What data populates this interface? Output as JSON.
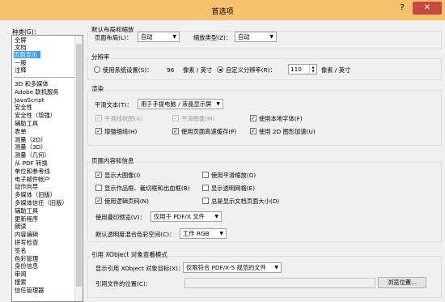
{
  "window": {
    "title": "首选项",
    "help": "?",
    "close": "✕"
  },
  "categories": {
    "label": "种类(G)：",
    "top": [
      "全屏",
      "文档",
      "页面显示"
    ],
    "top2": [
      "一般",
      "注释"
    ],
    "items": [
      "3D 和多媒体",
      "Adobe 联机服务",
      "JavaScript",
      "安全性",
      "安全性（增强）",
      "辅助工具",
      "表单",
      "测量（2D）",
      "测量（3D）",
      "测量（几何）",
      "从 PDF 转换",
      "单位和参考线",
      "电子邮件帐户",
      "动作向导",
      "多媒体（旧版）",
      "多媒体信任（旧版）",
      "辅助工具",
      "更新程序",
      "朗读",
      "内容编辑",
      "拼写检查",
      "签名",
      "色彩管理",
      "身份信息",
      "审阅",
      "搜索",
      "信任管理器"
    ],
    "selected": "页面显示"
  },
  "layout": {
    "title": "默认布局和缩放",
    "page_layout_label": "页面布局(L)：",
    "page_layout_value": "自动",
    "zoom_label": "缩放类型(Z)：",
    "zoom_value": "自动"
  },
  "resolution": {
    "title": "分辨率",
    "system_label": "使用系统设置(S)：",
    "system_value": "96",
    "system_unit": "像素 / 英寸",
    "custom_label": "自定义分辨率(R)：",
    "custom_value": "110",
    "custom_unit": "像素 / 英寸"
  },
  "rendering": {
    "title": "渲染",
    "smooth_text_label": "平滑文本(T)：",
    "smooth_text_value": "用于手提电脑 / 液晶显示屏",
    "smooth_line_art": "平滑线状图(A)",
    "smooth_images": "平滑图像(M)",
    "local_fonts": "使用本地字体(F)",
    "enhance_thin_lines": "增强细线(H)",
    "page_cache": "使用页面高速缓存(P)",
    "gpu_2d": "使用 2D 图形加速(U)"
  },
  "page_content": {
    "title": "页面内容和信息",
    "show_large_images": "显示大图像(I)",
    "smooth_zoom": "使用平滑缩放(O)",
    "show_art_trim": "显示作品框、裁切框和出血框(B)",
    "show_transparency_grid": "显示透明网格(E)",
    "logical_page_numbers": "使用逻辑页码(N)",
    "show_doc_page_size": "总是显示文档页面大小(D)",
    "overprint_label": "使用叠印预览(V)：",
    "overprint_value": "仅用于 PDF/X 文件",
    "blend_label": "默认透明度混合色彩空间(C)：",
    "blend_value": "工作 RGB"
  },
  "xobject": {
    "title": "引用 XObject 对象查看模式",
    "target_label": "显示引用 XObject 对象目标(X)：",
    "target_value": "仅限符合 PDF/X-5 规范的文件",
    "location_label": "引用文件的位置(C)：",
    "browse_button": "浏览位置..."
  }
}
